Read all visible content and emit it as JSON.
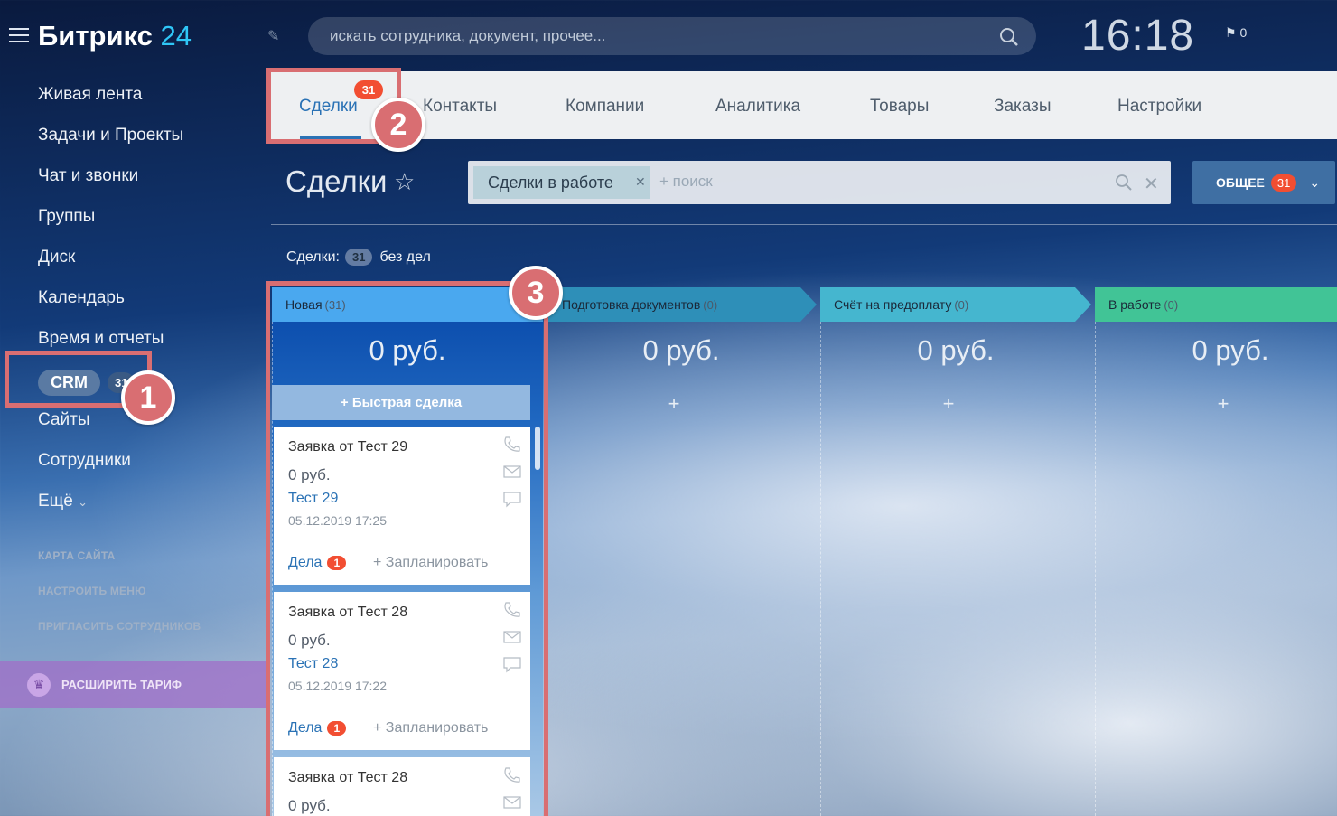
{
  "brand": {
    "name": "Битрикс",
    "suffix": "24"
  },
  "header": {
    "search_placeholder": "искать сотрудника, документ, прочее...",
    "time": "16:18",
    "notifications_count": "0"
  },
  "sidebar": {
    "items": [
      {
        "label": "Живая лента"
      },
      {
        "label": "Задачи и Проекты"
      },
      {
        "label": "Чат и звонки"
      },
      {
        "label": "Группы"
      },
      {
        "label": "Диск"
      },
      {
        "label": "Календарь"
      },
      {
        "label": "Время и отчеты"
      },
      {
        "label": "CRM",
        "badge": "31"
      },
      {
        "label": "Сайты"
      },
      {
        "label": "Сотрудники"
      },
      {
        "label": "Ещё",
        "caret": "⌄"
      }
    ],
    "links": [
      {
        "label": "КАРТА САЙТА"
      },
      {
        "label": "НАСТРОИТЬ МЕНЮ"
      },
      {
        "label": "ПРИГЛАСИТЬ СОТРУДНИКОВ"
      }
    ],
    "upgrade": {
      "label": "РАСШИРИТЬ ТАРИФ"
    }
  },
  "tabs": [
    {
      "label": "Сделки",
      "badge": "31"
    },
    {
      "label": "Контакты"
    },
    {
      "label": "Компании"
    },
    {
      "label": "Аналитика"
    },
    {
      "label": "Товары"
    },
    {
      "label": "Заказы"
    },
    {
      "label": "Настройки"
    }
  ],
  "page": {
    "title": "Сделки",
    "filter": {
      "chip": "Сделки в работе",
      "placeholder": "+ поиск"
    },
    "preset": {
      "label": "ОБЩЕЕ",
      "badge": "31"
    },
    "counter": {
      "label": "Сделки:",
      "count": "31",
      "suffix": "без дел"
    }
  },
  "kanban": {
    "quick_add": "+ Быстрая сделка",
    "plus": "+",
    "columns": [
      {
        "name": "Новая",
        "count": "(31)",
        "sum": "0 руб.",
        "color": "#4aa8ef"
      },
      {
        "name": "Подготовка документов",
        "count": "(0)",
        "sum": "0 руб.",
        "color": "#2e8fb8"
      },
      {
        "name": "Счёт на предоплату",
        "count": "(0)",
        "sum": "0 руб.",
        "color": "#45b6cf"
      },
      {
        "name": "В работе",
        "count": "(0)",
        "sum": "0 руб.",
        "color": "#41c496"
      }
    ],
    "cards": [
      {
        "title": "Заявка от Тест 29",
        "sum": "0 руб.",
        "contact": "Тест 29",
        "date": "05.12.2019 17:25",
        "tasks_label": "Дела",
        "tasks_count": "1",
        "plan": "+ Запланировать"
      },
      {
        "title": "Заявка от Тест 28",
        "sum": "0 руб.",
        "contact": "Тест 28",
        "date": "05.12.2019 17:22",
        "tasks_label": "Дела",
        "tasks_count": "1",
        "plan": "+ Запланировать"
      },
      {
        "title": "Заявка от Тест 28",
        "sum": "0 руб."
      }
    ]
  },
  "annotations": [
    {
      "number": "1"
    },
    {
      "number": "2"
    },
    {
      "number": "3"
    }
  ],
  "colors": {
    "accent": "#2a72b5",
    "badge": "#f24e32",
    "highlight": "#d96e72",
    "tab_bar": "#eef0f2"
  }
}
